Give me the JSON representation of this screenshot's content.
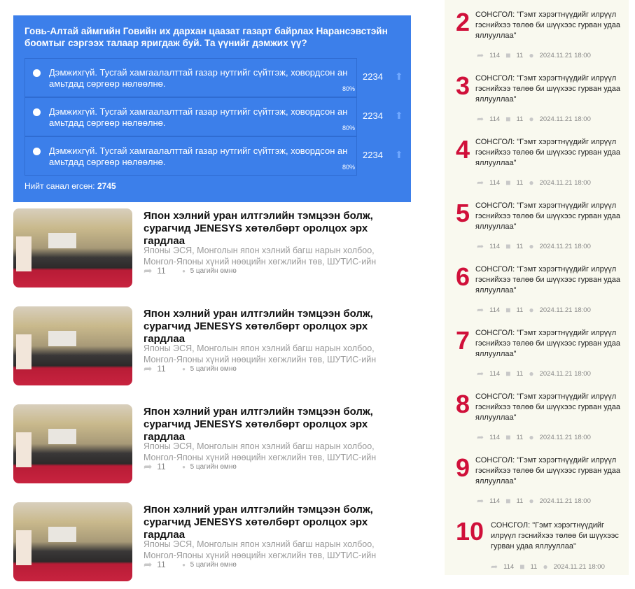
{
  "poll": {
    "question": "Говь-Алтай аймгийн Говийн их дархан цаазат газарт байрлах Наранcэвстэйн боомтыг сэргээх талаар яригдаж буй. Та үүнийг дэмжих үү?",
    "options": [
      {
        "text": "Дэмжихгүй. Тусгай хамгаалалттай газар нутгийг сүйтгэж, ховордсон ан амьтдад сөргөөр нөлөөлнө.",
        "percent": "80%",
        "count": "2234"
      },
      {
        "text": "Дэмжихгүй. Тусгай хамгаалалттай газар нутгийг сүйтгэж, ховордсон ан амьтдад сөргөөр нөлөөлнө.",
        "percent": "80%",
        "count": "2234"
      },
      {
        "text": "Дэмжихгүй. Тусгай хамгаалалттай газар нутгийг сүйтгэж, ховордсон ан амьтдад сөргөөр нөлөөлнө.",
        "percent": "80%",
        "count": "2234"
      }
    ],
    "total_label": "Нийт санал өгсөн:",
    "total": "2745"
  },
  "news": [
    {
      "title": "Япон хэлний уран илтгэлийн тэмцээн болж, сурагчид JENESYS хөтөлбөрт оролцох эрх гардлаа",
      "desc": "Японы ЭСЯ, Монголын япон хэлний багш нарын холбоо, Монгол-Японы хүний нөөцийн хөгжлийн төв, ШУТИС-ийн",
      "shares": "11",
      "time": "5 цагийн өмнө"
    },
    {
      "title": "Япон хэлний уран илтгэлийн тэмцээн болж, сурагчид JENESYS хөтөлбөрт оролцох эрх гардлаа",
      "desc": "Японы ЭСЯ, Монголын япон хэлний багш нарын холбоо, Монгол-Японы хүний нөөцийн хөгжлийн төв, ШУТИС-ийн",
      "shares": "11",
      "time": "5 цагийн өмнө"
    },
    {
      "title": "Япон хэлний уран илтгэлийн тэмцээн болж, сурагчид JENESYS хөтөлбөрт оролцох эрх гардлаа",
      "desc": "Японы ЭСЯ, Монголын япон хэлний багш нарын холбоо, Монгол-Японы хүний нөөцийн хөгжлийн төв, ШУТИС-ийн",
      "shares": "11",
      "time": "5 цагийн өмнө"
    },
    {
      "title": "Япон хэлний уран илтгэлийн тэмцээн болж, сурагчид JENESYS хөтөлбөрт оролцох эрх гардлаа",
      "desc": "Японы ЭСЯ, Монголын япон хэлний багш нарын холбоо, Монгол-Японы хүний нөөцийн хөгжлийн төв, ШУТИС-ийн",
      "shares": "11",
      "time": "5 цагийн өмнө"
    }
  ],
  "ranking": [
    {
      "rank": "2",
      "title": "СОНСГОЛ: \"Гэмт хэрэгтнүүдийг илрүүл гэснийхээ төлөө би шүүхээс гурван удаа яллууллаа\"",
      "shares": "114",
      "comments": "11",
      "date": "2024.11.21 18:00"
    },
    {
      "rank": "3",
      "title": "СОНСГОЛ: \"Гэмт хэрэгтнүүдийг илрүүл гэснийхээ төлөө би шүүхээс гурван удаа яллууллаа\"",
      "shares": "114",
      "comments": "11",
      "date": "2024.11.21 18:00"
    },
    {
      "rank": "4",
      "title": "СОНСГОЛ: \"Гэмт хэрэгтнүүдийг илрүүл гэснийхээ төлөө би шүүхээс гурван удаа яллууллаа\"",
      "shares": "114",
      "comments": "11",
      "date": "2024.11.21 18:00"
    },
    {
      "rank": "5",
      "title": "СОНСГОЛ: \"Гэмт хэрэгтнүүдийг илрүүл гэснийхээ төлөө би шүүхээс гурван удаа яллууллаа\"",
      "shares": "114",
      "comments": "11",
      "date": "2024.11.21 18:00"
    },
    {
      "rank": "6",
      "title": "СОНСГОЛ: \"Гэмт хэрэгтнүүдийг илрүүл гэснийхээ төлөө би шүүхээс гурван удаа яллууллаа\"",
      "shares": "114",
      "comments": "11",
      "date": "2024.11.21 18:00"
    },
    {
      "rank": "7",
      "title": "СОНСГОЛ: \"Гэмт хэрэгтнүүдийг илрүүл гэснийхээ төлөө би шүүхээс гурван удаа яллууллаа\"",
      "shares": "114",
      "comments": "11",
      "date": "2024.11.21 18:00"
    },
    {
      "rank": "8",
      "title": "СОНСГОЛ: \"Гэмт хэрэгтнүүдийг илрүүл гэснийхээ төлөө би шүүхээс гурван удаа яллууллаа\"",
      "shares": "114",
      "comments": "11",
      "date": "2024.11.21 18:00"
    },
    {
      "rank": "9",
      "title": "СОНСГОЛ: \"Гэмт хэрэгтнүүдийг илрүүл гэснийхээ төлөө би шүүхээс гурван удаа яллууллаа\"",
      "shares": "114",
      "comments": "11",
      "date": "2024.11.21 18:00"
    },
    {
      "rank": "10",
      "title": "СОНСГОЛ: \"Гэмт хэрэгтнүүдийг илрүүл гэснийхээ төлөө би шүүхээс гурван удаа яллууллаа\"",
      "shares": "114",
      "comments": "11",
      "date": "2024.11.21 18:00"
    }
  ]
}
